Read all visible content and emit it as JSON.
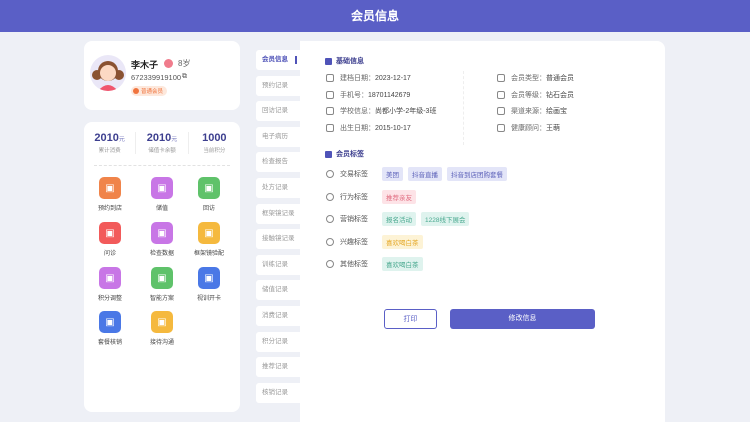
{
  "header": {
    "title": "会员信息"
  },
  "profile": {
    "name": "李木子",
    "age": "8岁",
    "phone": "672339919100",
    "level_badge": "普通会员"
  },
  "stats": [
    {
      "value": "2010",
      "unit": "元",
      "label": "累计消费"
    },
    {
      "value": "2010",
      "unit": "元",
      "label": "储值卡余额"
    },
    {
      "value": "1000",
      "unit": "",
      "label": "当前积分"
    }
  ],
  "functions": [
    {
      "label": "预约到店",
      "color": "#f0844a",
      "icon": "calendar-icon"
    },
    {
      "label": "储值",
      "color": "#c876e6",
      "icon": "card-icon"
    },
    {
      "label": "回访",
      "color": "#5fc26a",
      "icon": "chat-icon"
    },
    {
      "label": "问诊",
      "color": "#f25a5a",
      "icon": "consult-icon"
    },
    {
      "label": "检查数据",
      "color": "#c876e6",
      "icon": "image-icon"
    },
    {
      "label": "框架镜验配",
      "color": "#f5b93e",
      "icon": "glasses-icon"
    },
    {
      "label": "积分调整",
      "color": "#c876e6",
      "icon": "database-icon"
    },
    {
      "label": "智能方案",
      "color": "#5fc26a",
      "icon": "ai-icon"
    },
    {
      "label": "视训开卡",
      "color": "#4a78e6",
      "icon": "window-add-icon"
    },
    {
      "label": "套餐核销",
      "color": "#4a78e6",
      "icon": "package-icon"
    },
    {
      "label": "接待沟通",
      "color": "#f5b93e",
      "icon": "reception-icon"
    }
  ],
  "tabs": [
    "会员信息",
    "预约记录",
    "回访记录",
    "电子病历",
    "检查报告",
    "处方记录",
    "框架镜记录",
    "接触镜记录",
    "训练记录",
    "储值记录",
    "消费记录",
    "积分记录",
    "推荐记录",
    "核销记录"
  ],
  "basic": {
    "title": "基础信息",
    "left": [
      {
        "k": "建档日期：",
        "v": "2023-12-17"
      },
      {
        "k": "手机号：",
        "v": "18701142679"
      },
      {
        "k": "学校信息：",
        "v": "尚都小学-2年级-3班"
      },
      {
        "k": "出生日期：",
        "v": "2015-10-17"
      }
    ],
    "right": [
      {
        "k": "会员类型：",
        "v": "普通会员"
      },
      {
        "k": "会员等级：",
        "v": "钻石会员"
      },
      {
        "k": "渠道来源：",
        "v": "绘画宝"
      },
      {
        "k": "健康顾问：",
        "v": "王萌"
      }
    ]
  },
  "tags": {
    "title": "会员标签",
    "rows": [
      {
        "k": "交易标签",
        "tags": [
          "美团",
          "抖音直播",
          "抖音到店团购套餐"
        ]
      },
      {
        "k": "行为标签",
        "tags": [
          "推荐亲友"
        ]
      },
      {
        "k": "营销标签",
        "tags": [
          "报名活动",
          "1228线下展会"
        ]
      },
      {
        "k": "兴趣标签",
        "tags": [
          "喜欢喝白茶"
        ]
      },
      {
        "k": "其他标签",
        "tags": [
          "喜欢喝白茶"
        ]
      }
    ]
  },
  "buttons": {
    "print": "打印",
    "edit": "修改信息"
  }
}
